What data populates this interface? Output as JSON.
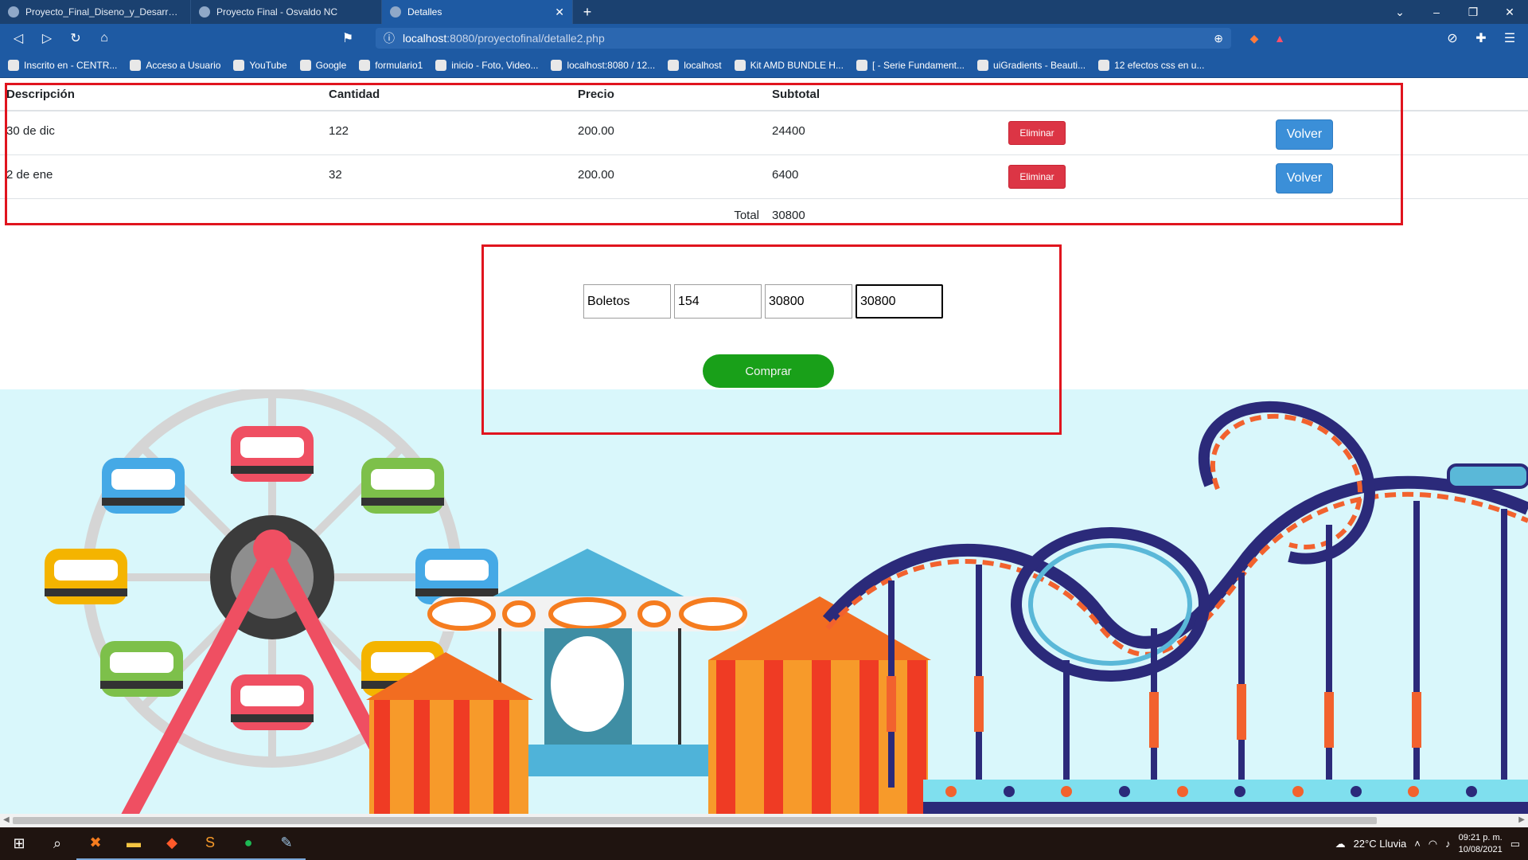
{
  "browser": {
    "tabs": [
      {
        "label": "Proyecto_Final_Diseno_y_Desarrollo_C",
        "active": false
      },
      {
        "label": "Proyecto Final - Osvaldo NC",
        "active": false
      },
      {
        "label": "Detalles",
        "active": true
      }
    ],
    "url_host": "localhost",
    "url_path": ":8080/proyectofinal/detalle2.php",
    "bookmarks": [
      "Inscrito en - CENTR...",
      "Acceso a Usuario",
      "YouTube",
      "Google",
      "formulario1",
      "inicio - Foto, Video...",
      "localhost:8080 / 12...",
      "localhost",
      "Kit AMD BUNDLE H...",
      "[ - Serie Fundament...",
      "uiGradients - Beauti...",
      "12 efectos css en u..."
    ]
  },
  "table": {
    "headers": [
      "Descripción",
      "Cantidad",
      "Precio",
      "Subtotal"
    ],
    "rows": [
      {
        "descripcion": "30 de dic",
        "cantidad": "122",
        "precio": "200.00",
        "subtotal": "24400",
        "delete_label": "Eliminar",
        "back_label": "Volver"
      },
      {
        "descripcion": "2 de ene",
        "cantidad": "32",
        "precio": "200.00",
        "subtotal": "6400",
        "delete_label": "Eliminar",
        "back_label": "Volver"
      }
    ],
    "total_label": "Total",
    "total_value": "30800"
  },
  "form": {
    "producto": "Boletos",
    "cantidad": "154",
    "subtotal": "30800",
    "total": "30800",
    "buy_label": "Comprar"
  },
  "taskbar": {
    "weather": "22°C  Lluvia",
    "time": "09:21 p. m.",
    "date": "10/08/2021"
  },
  "colors": {
    "browser_tabbar": "#1b4170",
    "browser_toolbar": "#1e5aa3",
    "highlight_red": "#e0141e",
    "danger": "#dc3545",
    "primary": "#3b8fd8",
    "buy_green": "#19a019",
    "sky": "#d9f7fb"
  }
}
